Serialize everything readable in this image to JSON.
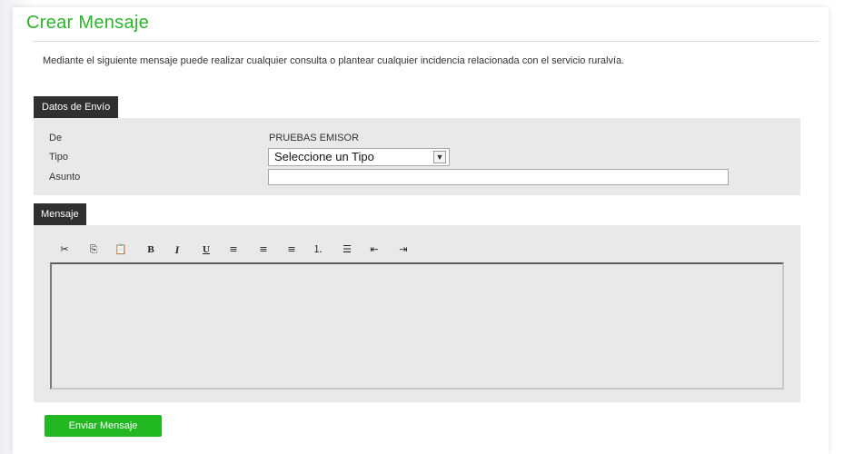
{
  "page": {
    "title": "Crear Mensaje",
    "intro": "Mediante el siguiente mensaje puede realizar cualquier consulta o plantear cualquier incidencia relacionada con el servicio ruralvía."
  },
  "datos_envio": {
    "section_title": "Datos de Envío",
    "de_label": "De",
    "de_value": "PRUEBAS EMISOR",
    "tipo_label": "Tipo",
    "tipo_selected": "Seleccione un Tipo",
    "asunto_label": "Asunto",
    "asunto_value": ""
  },
  "mensaje": {
    "section_title": "Mensaje",
    "toolbar": {
      "cut": "✂",
      "copy": "⎘",
      "paste": "📋",
      "bold": "B",
      "italic": "I",
      "underline": "U",
      "align_left": "≡",
      "align_center": "≡",
      "align_right": "≡",
      "ordered_list": "⒈",
      "unordered_list": "☰",
      "outdent": "⇤",
      "indent": "⇥"
    },
    "body_value": ""
  },
  "actions": {
    "send_label": "Enviar Mensaje"
  },
  "colors": {
    "accent": "#2bb52b",
    "button": "#22b822",
    "tab": "#303030",
    "section_bg": "#e9e9e9"
  }
}
